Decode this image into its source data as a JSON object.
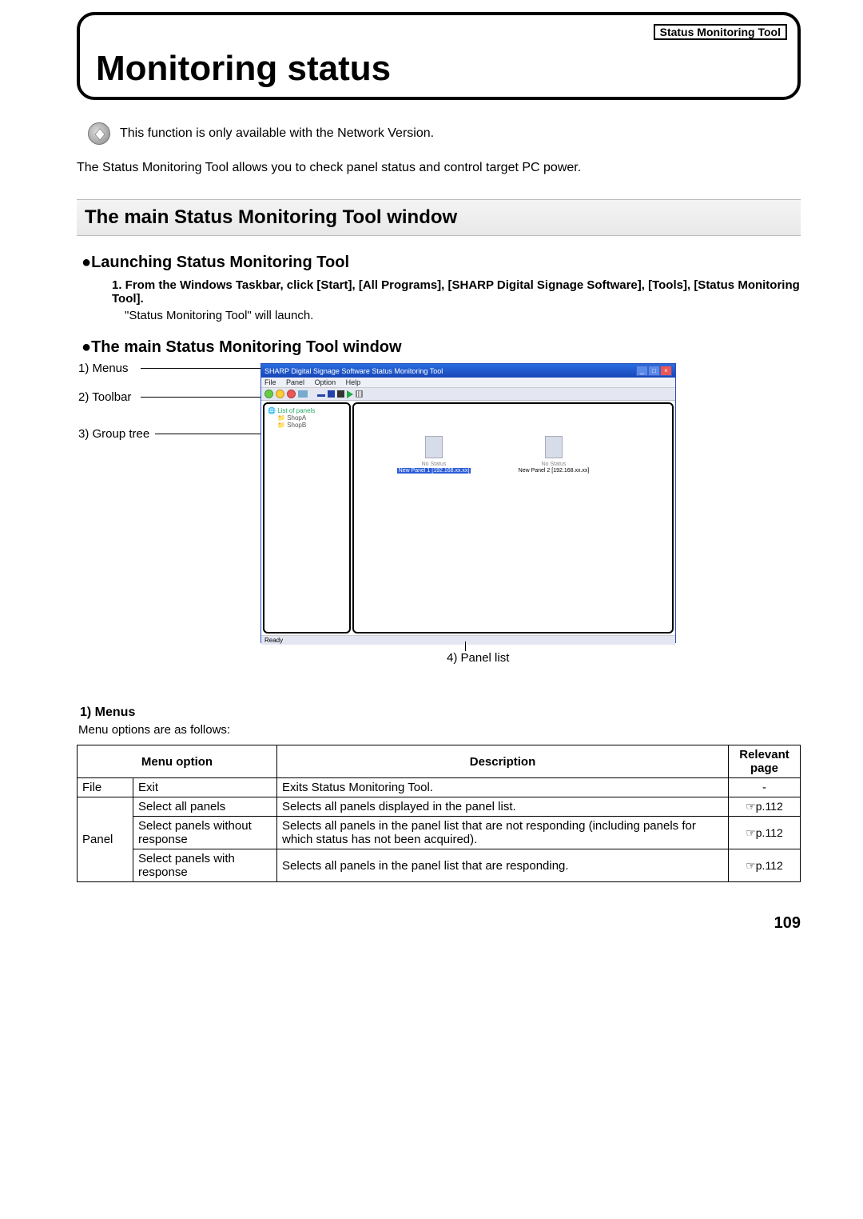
{
  "top_tag": "Status Monitoring Tool",
  "title": "Monitoring status",
  "info_text": "This function is only available with the Network Version.",
  "intro_text": "The Status Monitoring Tool allows you to check panel status and control target PC power.",
  "section_heading": "The main Status Monitoring Tool window",
  "sub_launch": "●Launching Status Monitoring Tool",
  "step1": "1.  From the Windows Taskbar, click [Start], [All Programs], [SHARP Digital Signage Software], [Tools], [Status Monitoring Tool].",
  "step1_result": "\"Status Monitoring Tool\" will launch.",
  "sub_main_window": "●The main Status Monitoring Tool window",
  "callouts": {
    "menus": "1) Menus",
    "toolbar": "2) Toolbar",
    "group_tree": "3) Group tree",
    "panel_list": "4) Panel list"
  },
  "app_window": {
    "title": "SHARP Digital Signage Software Status Monitoring Tool",
    "menus": [
      "File",
      "Panel",
      "Option",
      "Help"
    ],
    "tree": {
      "root": "List of panels",
      "items": [
        "ShopA",
        "ShopB"
      ]
    },
    "panels": [
      {
        "status": "No Status",
        "label": "New Panel 1 [192.168.xx.xx]",
        "selected": true
      },
      {
        "status": "No Status",
        "label": "New Panel 2 [192.168.xx.xx]",
        "selected": false
      }
    ],
    "statusbar": "Ready"
  },
  "menus_heading": "1) Menus",
  "menus_intro": "Menu options are as follows:",
  "table": {
    "headers": {
      "menu_option": "Menu option",
      "description": "Description",
      "relevant_page": "Relevant page"
    },
    "rows": [
      {
        "menu": "File",
        "option": "Exit",
        "desc": "Exits Status Monitoring Tool.",
        "page": "-"
      },
      {
        "menu": "Panel",
        "option": "Select all panels",
        "desc": "Selects all panels displayed in the panel list.",
        "page": "☞p.112"
      },
      {
        "menu": "",
        "option": "Select panels without response",
        "desc": "Selects all panels in the panel list that are not responding (including panels for which status has not been acquired).",
        "page": "☞p.112"
      },
      {
        "menu": "",
        "option": "Select panels with response",
        "desc": "Selects all panels in the panel list that are responding.",
        "page": "☞p.112"
      }
    ]
  },
  "page_number": "109"
}
